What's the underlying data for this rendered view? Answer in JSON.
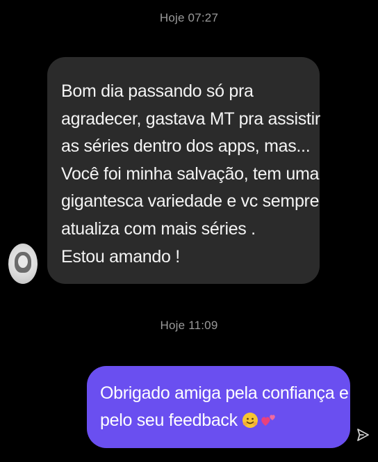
{
  "timestamps": {
    "first": "Hoje 07:27",
    "second": "Hoje 11:09"
  },
  "incoming_message": {
    "lines": [
      "Bom dia passando só pra",
      "agradecer, gastava MT pra assistir",
      "as séries dentro dos apps, mas...",
      "Você foi minha salvação, tem uma",
      "gigantesca variedade e vc sempre",
      "atualiza com mais séries .",
      "Estou amando !"
    ]
  },
  "outgoing_message": {
    "lines": [
      "Obrigado amiga pela confiança e",
      "pelo seu feedback"
    ],
    "emojis": [
      "hugging-face-emoji",
      "two-hearts-emoji"
    ]
  },
  "icons": {
    "avatar": "contact-avatar",
    "send": "send-icon"
  },
  "colors": {
    "background": "#000000",
    "incoming_bubble": "#2b2b2b",
    "outgoing_bubble": "#6a4ff0",
    "timestamp_text": "#9a9a9a"
  }
}
